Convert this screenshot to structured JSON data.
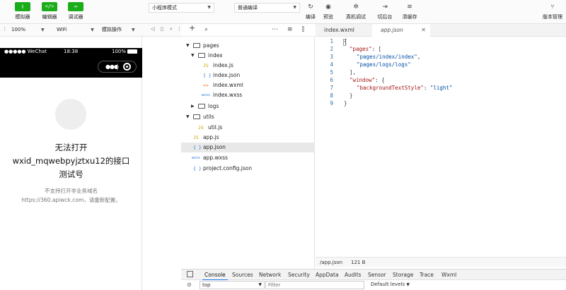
{
  "toolbar": {
    "simulator_label": "模拟器",
    "editor_label": "编辑器",
    "debugger_label": "调试器",
    "mode_select": "小程序模式",
    "compile_select": "普通编译",
    "compile_label": "编译",
    "preview_label": "预览",
    "remote_debug_label": "真机调试",
    "background_label": "切后台",
    "clear_cache_label": "清缓存",
    "version_label": "版本管理"
  },
  "sim_toolbar": {
    "zoom": "100%",
    "network": "WiFi",
    "operation": "模拟操作"
  },
  "simulator": {
    "carrier": "●●●●● WeChat",
    "time": "18:38",
    "battery": "100%",
    "error_title_line1": "无法打开",
    "error_title_line2": "wxid_mqwebpyjztxu12的接口",
    "error_title_line3": "测试号",
    "error_sub_line1": "不支持打开非业务域名",
    "error_sub_line2": "https://360.apiwck.com，请重新配置。"
  },
  "explorer": {
    "items": [
      {
        "name": "pages",
        "type": "folder",
        "icon": "folder-icon"
      },
      {
        "name": "index",
        "type": "folder",
        "icon": "folder-icon"
      },
      {
        "name": "index.js",
        "type": "file",
        "icon": "JS"
      },
      {
        "name": "index.json",
        "type": "file",
        "icon": "{ }"
      },
      {
        "name": "index.wxml",
        "type": "file",
        "icon": "<>"
      },
      {
        "name": "index.wxss",
        "type": "file",
        "icon": "wxss"
      },
      {
        "name": "logs",
        "type": "folder",
        "icon": "folder-icon"
      },
      {
        "name": "utils",
        "type": "folder",
        "icon": "folder-icon"
      },
      {
        "name": "util.js",
        "type": "file",
        "icon": "JS"
      },
      {
        "name": "app.js",
        "type": "file",
        "icon": "JS"
      },
      {
        "name": "app.json",
        "type": "file",
        "icon": "{ }"
      },
      {
        "name": "app.wxss",
        "type": "file",
        "icon": "wxss"
      },
      {
        "name": "project.config.json",
        "type": "file",
        "icon": "{ }"
      }
    ]
  },
  "editor": {
    "tabs": [
      "index.wxml",
      "app.json"
    ],
    "line_numbers": [
      "1",
      "2",
      "3",
      "4",
      "5",
      "6",
      "7",
      "8",
      "9"
    ],
    "code": {
      "l1": "{",
      "l2_key": "\"pages\"",
      "l2_rest": ": [",
      "l3": "\"pages/index/index\"",
      "l3_rest": ",",
      "l4": "\"pages/logs/logs\"",
      "l5": "],",
      "l6_key": "\"window\"",
      "l6_rest": ": {",
      "l7_key": "\"backgroundTextStyle\"",
      "l7_mid": ": ",
      "l7_val": "\"light\"",
      "l8": "}",
      "l9": "}"
    },
    "status_path": "/app.json",
    "status_size": "121 B"
  },
  "devtools": {
    "tabs": [
      "Console",
      "Sources",
      "Network",
      "Security",
      "AppData",
      "Audits",
      "Sensor",
      "Storage",
      "Trace",
      "Wxml"
    ],
    "context": "top",
    "filter_placeholder": "Filter",
    "levels": "Default levels"
  }
}
